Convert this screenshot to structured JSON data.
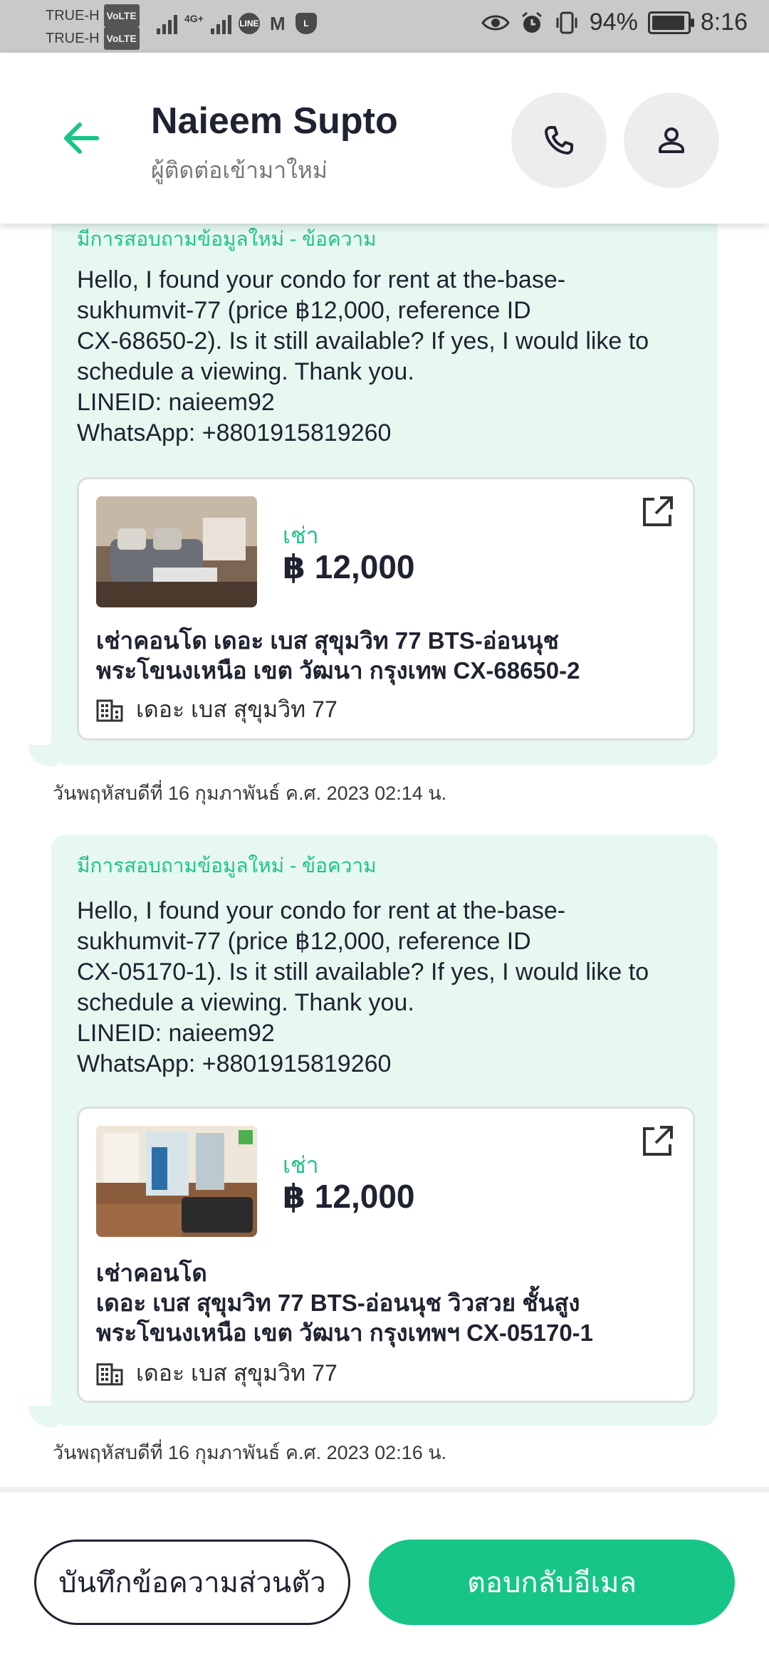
{
  "status_bar": {
    "carrier_1": "TRUE-H",
    "carrier_2": "TRUE-H",
    "volte": "VoLTE",
    "network": "4G+",
    "battery": "94%",
    "battery_level": 0.94,
    "time": "8:16"
  },
  "header": {
    "name": "Naieem Supto",
    "subtitle": "ผู้ติดต่อเข้ามาใหม่"
  },
  "messages": [
    {
      "heading": "มีการสอบถามข้อมูลใหม่ - ข้อความ",
      "body_lines": [
        "Hello, I found your condo for rent at the-base-",
        "sukhumvit-77 (price ฿12,000, reference ID",
        "CX-68650-2). Is it still available? If yes, I would like to",
        "schedule a viewing. Thank you.",
        "LINEID: naieem92",
        "WhatsApp: +8801915819260"
      ],
      "listing": {
        "type": "เช่า",
        "price": "฿ 12,000",
        "title_lines": [
          "เช่าคอนโด  เดอะ เบส สุขุมวิท 77 BTS-อ่อนนุช",
          "พระโขนงเหนือ เขต วัฒนา กรุงเทพ CX-68650-2"
        ],
        "location": "เดอะ เบส สุขุมวิท 77"
      },
      "timestamp": "วันพฤหัสบดีที่ 16 กุมภาพันธ์ ค.ศ. 2023 02:14 น."
    },
    {
      "heading": "มีการสอบถามข้อมูลใหม่ - ข้อความ",
      "body_lines": [
        "Hello, I found your condo for rent at the-base-",
        "sukhumvit-77 (price ฿12,000, reference ID",
        "CX-05170-1). Is it still available? If yes, I would like to",
        "schedule a viewing. Thank you.",
        "LINEID: naieem92",
        "WhatsApp: +8801915819260"
      ],
      "listing": {
        "type": "เช่า",
        "price": "฿ 12,000",
        "title_lines": [
          "เช่าคอนโด",
          "เดอะ เบส สุขุมวิท 77 BTS-อ่อนนุช วิวสวย ชั้นสูง",
          "พระโขนงเหนือ เขต วัฒนา กรุงเทพฯ CX-05170-1"
        ],
        "location": "เดอะ เบส สุขุมวิท 77"
      },
      "timestamp": "วันพฤหัสบดีที่ 16 กุมภาพันธ์ ค.ศ. 2023 02:16 น."
    }
  ],
  "actions": {
    "private_note": "บันทึกข้อความส่วนตัว",
    "reply_email": "ตอบกลับอีเมล"
  },
  "colors": {
    "accent": "#17c586",
    "bubble": "#e6f8f0",
    "text": "#1f2230"
  },
  "icons": [
    "back-arrow-icon",
    "phone-icon",
    "person-icon",
    "external-link-icon",
    "building-icon"
  ]
}
